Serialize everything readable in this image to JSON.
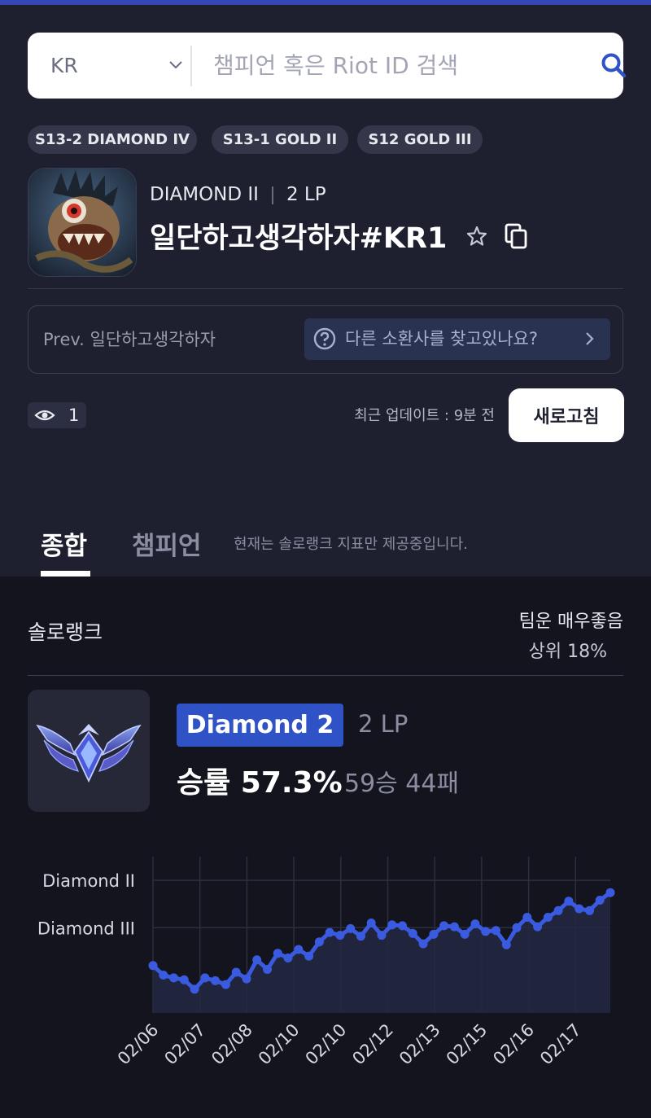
{
  "search": {
    "region": "KR",
    "placeholder": "챔피언 혹은 Riot ID 검색",
    "value": ""
  },
  "season_badges": [
    "S13-2 DIAMOND IV",
    "S13-1 GOLD II",
    "S12 GOLD III"
  ],
  "profile": {
    "tier": "DIAMOND II",
    "lp": "2 LP",
    "name": "일단하고생각하자#KR1",
    "prev_name": "Prev. 일단하고생각하자",
    "other_summoner": "다른 소환사를 찾고있나요?"
  },
  "stats": {
    "views": "1",
    "updated": "최근 업데이트 : 9분 전",
    "refresh_label": "새로고침"
  },
  "tabs": {
    "overview": "종합",
    "champion": "챔피언",
    "note": "현재는 솔로랭크 지표만 제공중입니다."
  },
  "solo": {
    "title": "솔로랭크",
    "team_luck": "팀운 매우좋음",
    "top_percent": "상위 18%",
    "rank": "Diamond 2",
    "lp": "2 LP",
    "winrate_label": "승률 57.3%",
    "record": "59승 44패"
  },
  "colors": {
    "accent": "#2f52c7",
    "line": "#3a5be0",
    "upper_bg": "#1e2030",
    "lower_bg": "#13141e"
  },
  "chart_data": {
    "type": "line",
    "x": [
      "02/06",
      "02/07",
      "02/08",
      "02/10",
      "02/10",
      "02/12",
      "02/13",
      "02/15",
      "02/16",
      "02/17"
    ],
    "y_ticks": [
      "Diamond II",
      "Diamond III"
    ],
    "ylim": [
      -40,
      125
    ],
    "values": [
      10,
      0,
      -3,
      -5,
      -15,
      -3,
      -6,
      -10,
      3,
      -4,
      16,
      6,
      23,
      18,
      27,
      20,
      35,
      45,
      42,
      49,
      41,
      55,
      42,
      53,
      52,
      44,
      33,
      43,
      52,
      51,
      43,
      54,
      46,
      47,
      32,
      50,
      61,
      51,
      61,
      68,
      78,
      70,
      68,
      79,
      87
    ],
    "grid": true
  }
}
